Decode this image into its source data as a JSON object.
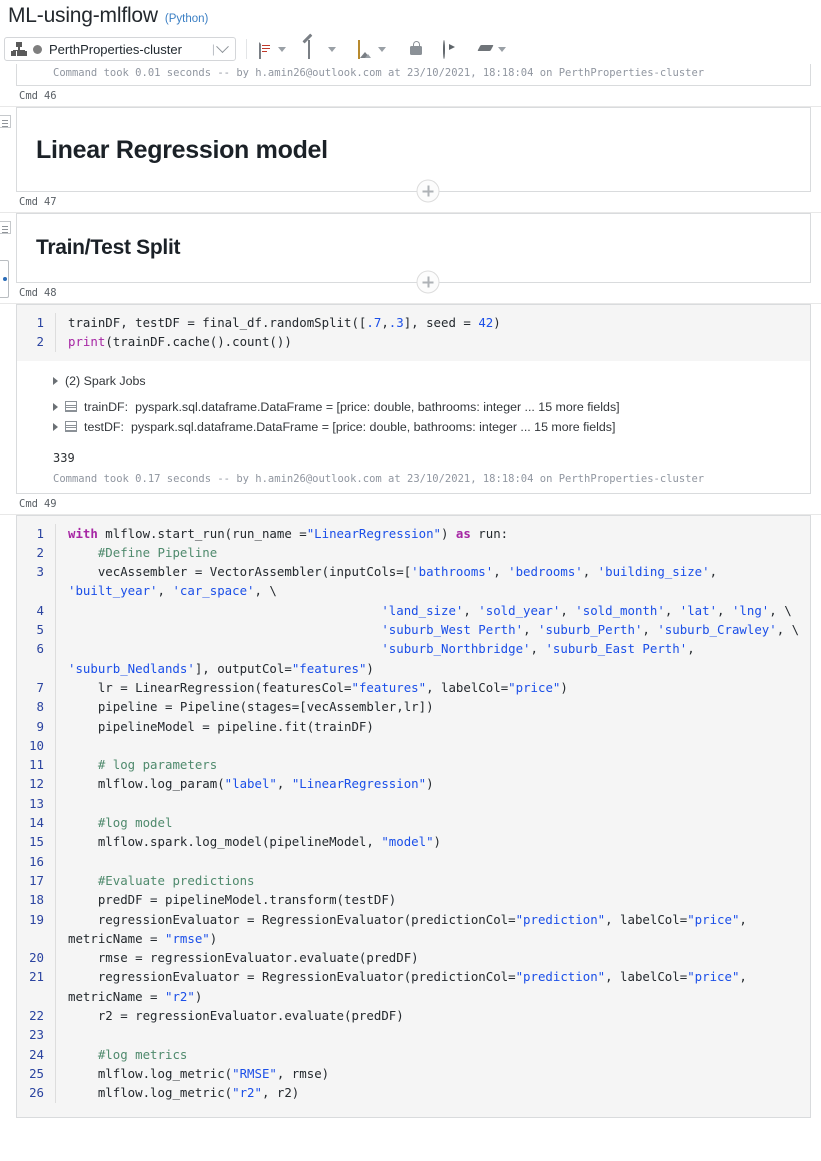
{
  "notebook": {
    "title": "ML-using-mlflow",
    "language": "(Python)"
  },
  "toolbar": {
    "cluster_name": "PerthProperties-cluster",
    "cluster_status": "detached",
    "pipe": "|",
    "icons": [
      {
        "name": "cluster-icon"
      },
      {
        "name": "file-menu-icon"
      },
      {
        "name": "edit-menu-icon"
      },
      {
        "name": "view-menu-icon"
      },
      {
        "name": "permissions-lock-icon"
      },
      {
        "name": "run-all-icon"
      },
      {
        "name": "clear-eraser-icon"
      }
    ]
  },
  "cells": [
    {
      "id": "cmd-45-footer",
      "footer": "Command took 0.01 seconds -- by h.amin26@outlook.com at 23/10/2021, 18:18:04 on PerthProperties-cluster"
    },
    {
      "label_prefix": "Cmd",
      "label_num": "46",
      "type": "markdown",
      "heading": "Linear Regression model"
    },
    {
      "label_prefix": "Cmd",
      "label_num": "47",
      "type": "markdown",
      "heading": "Train/Test Split"
    },
    {
      "label_prefix": "Cmd",
      "label_num": "48",
      "type": "code",
      "lines": [
        {
          "n": "1",
          "html": "trainDF, testDF = final_df.randomSplit([<span class=\"n\">.7</span>,<span class=\"n\">.3</span>], seed = <span class=\"n\">42</span>)"
        },
        {
          "n": "2",
          "html": "<span style=\"color:#a626a4\">print</span>(trainDF.cache().count())"
        }
      ],
      "results": {
        "spark_jobs": "(2) Spark Jobs",
        "vars": [
          {
            "name": "trainDF:",
            "desc": "pyspark.sql.dataframe.DataFrame = [price: double, bathrooms: integer ... 15 more fields]"
          },
          {
            "name": "testDF:",
            "desc": "pyspark.sql.dataframe.DataFrame = [price: double, bathrooms: integer ... 15 more fields]"
          }
        ],
        "stdout": "339"
      },
      "footer": "Command took 0.17 seconds -- by h.amin26@outlook.com at 23/10/2021, 18:18:04 on PerthProperties-cluster"
    },
    {
      "label_prefix": "Cmd",
      "label_num": "49",
      "type": "code",
      "lines": [
        {
          "n": "1",
          "html": "<span class=\"k\">with</span> mlflow.start_run(run_name =<span class=\"s\">\"LinearRegression\"</span>) <span class=\"k\">as</span> run:"
        },
        {
          "n": "2",
          "html": "    <span class=\"c\">#Define Pipeline</span>"
        },
        {
          "n": "3",
          "html": "    vecAssembler = VectorAssembler(inputCols=[<span class=\"s\">'bathrooms'</span>, <span class=\"s\">'bedrooms'</span>, <span class=\"s\">'building_size'</span>, <span class=\"s\">'built_year'</span>, <span class=\"s\">'car_space'</span>, \\"
        },
        {
          "n": "4",
          "html": "                                          <span class=\"s\">'land_size'</span>, <span class=\"s\">'sold_year'</span>, <span class=\"s\">'sold_month'</span>, <span class=\"s\">'lat'</span>, <span class=\"s\">'lng'</span>, \\"
        },
        {
          "n": "5",
          "html": "                                          <span class=\"s\">'suburb_West Perth'</span>, <span class=\"s\">'suburb_Perth'</span>, <span class=\"s\">'suburb_Crawley'</span>, \\"
        },
        {
          "n": "6",
          "html": "                                          <span class=\"s\">'suburb_Northbridge'</span>, <span class=\"s\">'suburb_East Perth'</span>, <span class=\"s\">'suburb_Nedlands'</span>], outputCol=<span class=\"s\">\"features\"</span>)"
        },
        {
          "n": "7",
          "html": "    lr = LinearRegression(featuresCol=<span class=\"s\">\"features\"</span>, labelCol=<span class=\"s\">\"price\"</span>)"
        },
        {
          "n": "8",
          "html": "    pipeline = Pipeline(stages=[vecAssembler,lr])"
        },
        {
          "n": "9",
          "html": "    pipelineModel = pipeline.fit(trainDF)"
        },
        {
          "n": "10",
          "html": ""
        },
        {
          "n": "11",
          "html": "    <span class=\"c\"># log parameters</span>"
        },
        {
          "n": "12",
          "html": "    mlflow.log_param(<span class=\"s\">\"label\"</span>, <span class=\"s\">\"LinearRegression\"</span>)"
        },
        {
          "n": "13",
          "html": ""
        },
        {
          "n": "14",
          "html": "    <span class=\"c\">#log model</span>"
        },
        {
          "n": "15",
          "html": "    mlflow.spark.log_model(pipelineModel, <span class=\"s\">\"model\"</span>)"
        },
        {
          "n": "16",
          "html": ""
        },
        {
          "n": "17",
          "html": "    <span class=\"c\">#Evaluate predictions</span>"
        },
        {
          "n": "18",
          "html": "    predDF = pipelineModel.transform(testDF)"
        },
        {
          "n": "19",
          "html": "    regressionEvaluator = RegressionEvaluator(predictionCol=<span class=\"s\">\"prediction\"</span>, labelCol=<span class=\"s\">\"price\"</span>, metricName = <span class=\"s\">\"rmse\"</span>)"
        },
        {
          "n": "20",
          "html": "    rmse = regressionEvaluator.evaluate(predDF)"
        },
        {
          "n": "21",
          "html": "    regressionEvaluator = RegressionEvaluator(predictionCol=<span class=\"s\">\"prediction\"</span>, labelCol=<span class=\"s\">\"price\"</span>, metricName = <span class=\"s\">\"r2\"</span>)"
        },
        {
          "n": "22",
          "html": "    r2 = regressionEvaluator.evaluate(predDF)"
        },
        {
          "n": "23",
          "html": ""
        },
        {
          "n": "24",
          "html": "    <span class=\"c\">#log metrics</span>"
        },
        {
          "n": "25",
          "html": "    mlflow.log_metric(<span class=\"s\">\"RMSE\"</span>, rmse)"
        },
        {
          "n": "26",
          "html": "    mlflow.log_metric(<span class=\"s\">\"r2\"</span>, r2)"
        }
      ]
    }
  ],
  "colors": {
    "accent": "#2b44a0",
    "string": "#1b4fe8",
    "comment": "#4f8a6d",
    "keyword": "#a626a4",
    "link": "#3b7fc4",
    "code_bg": "#f5f5f5"
  }
}
